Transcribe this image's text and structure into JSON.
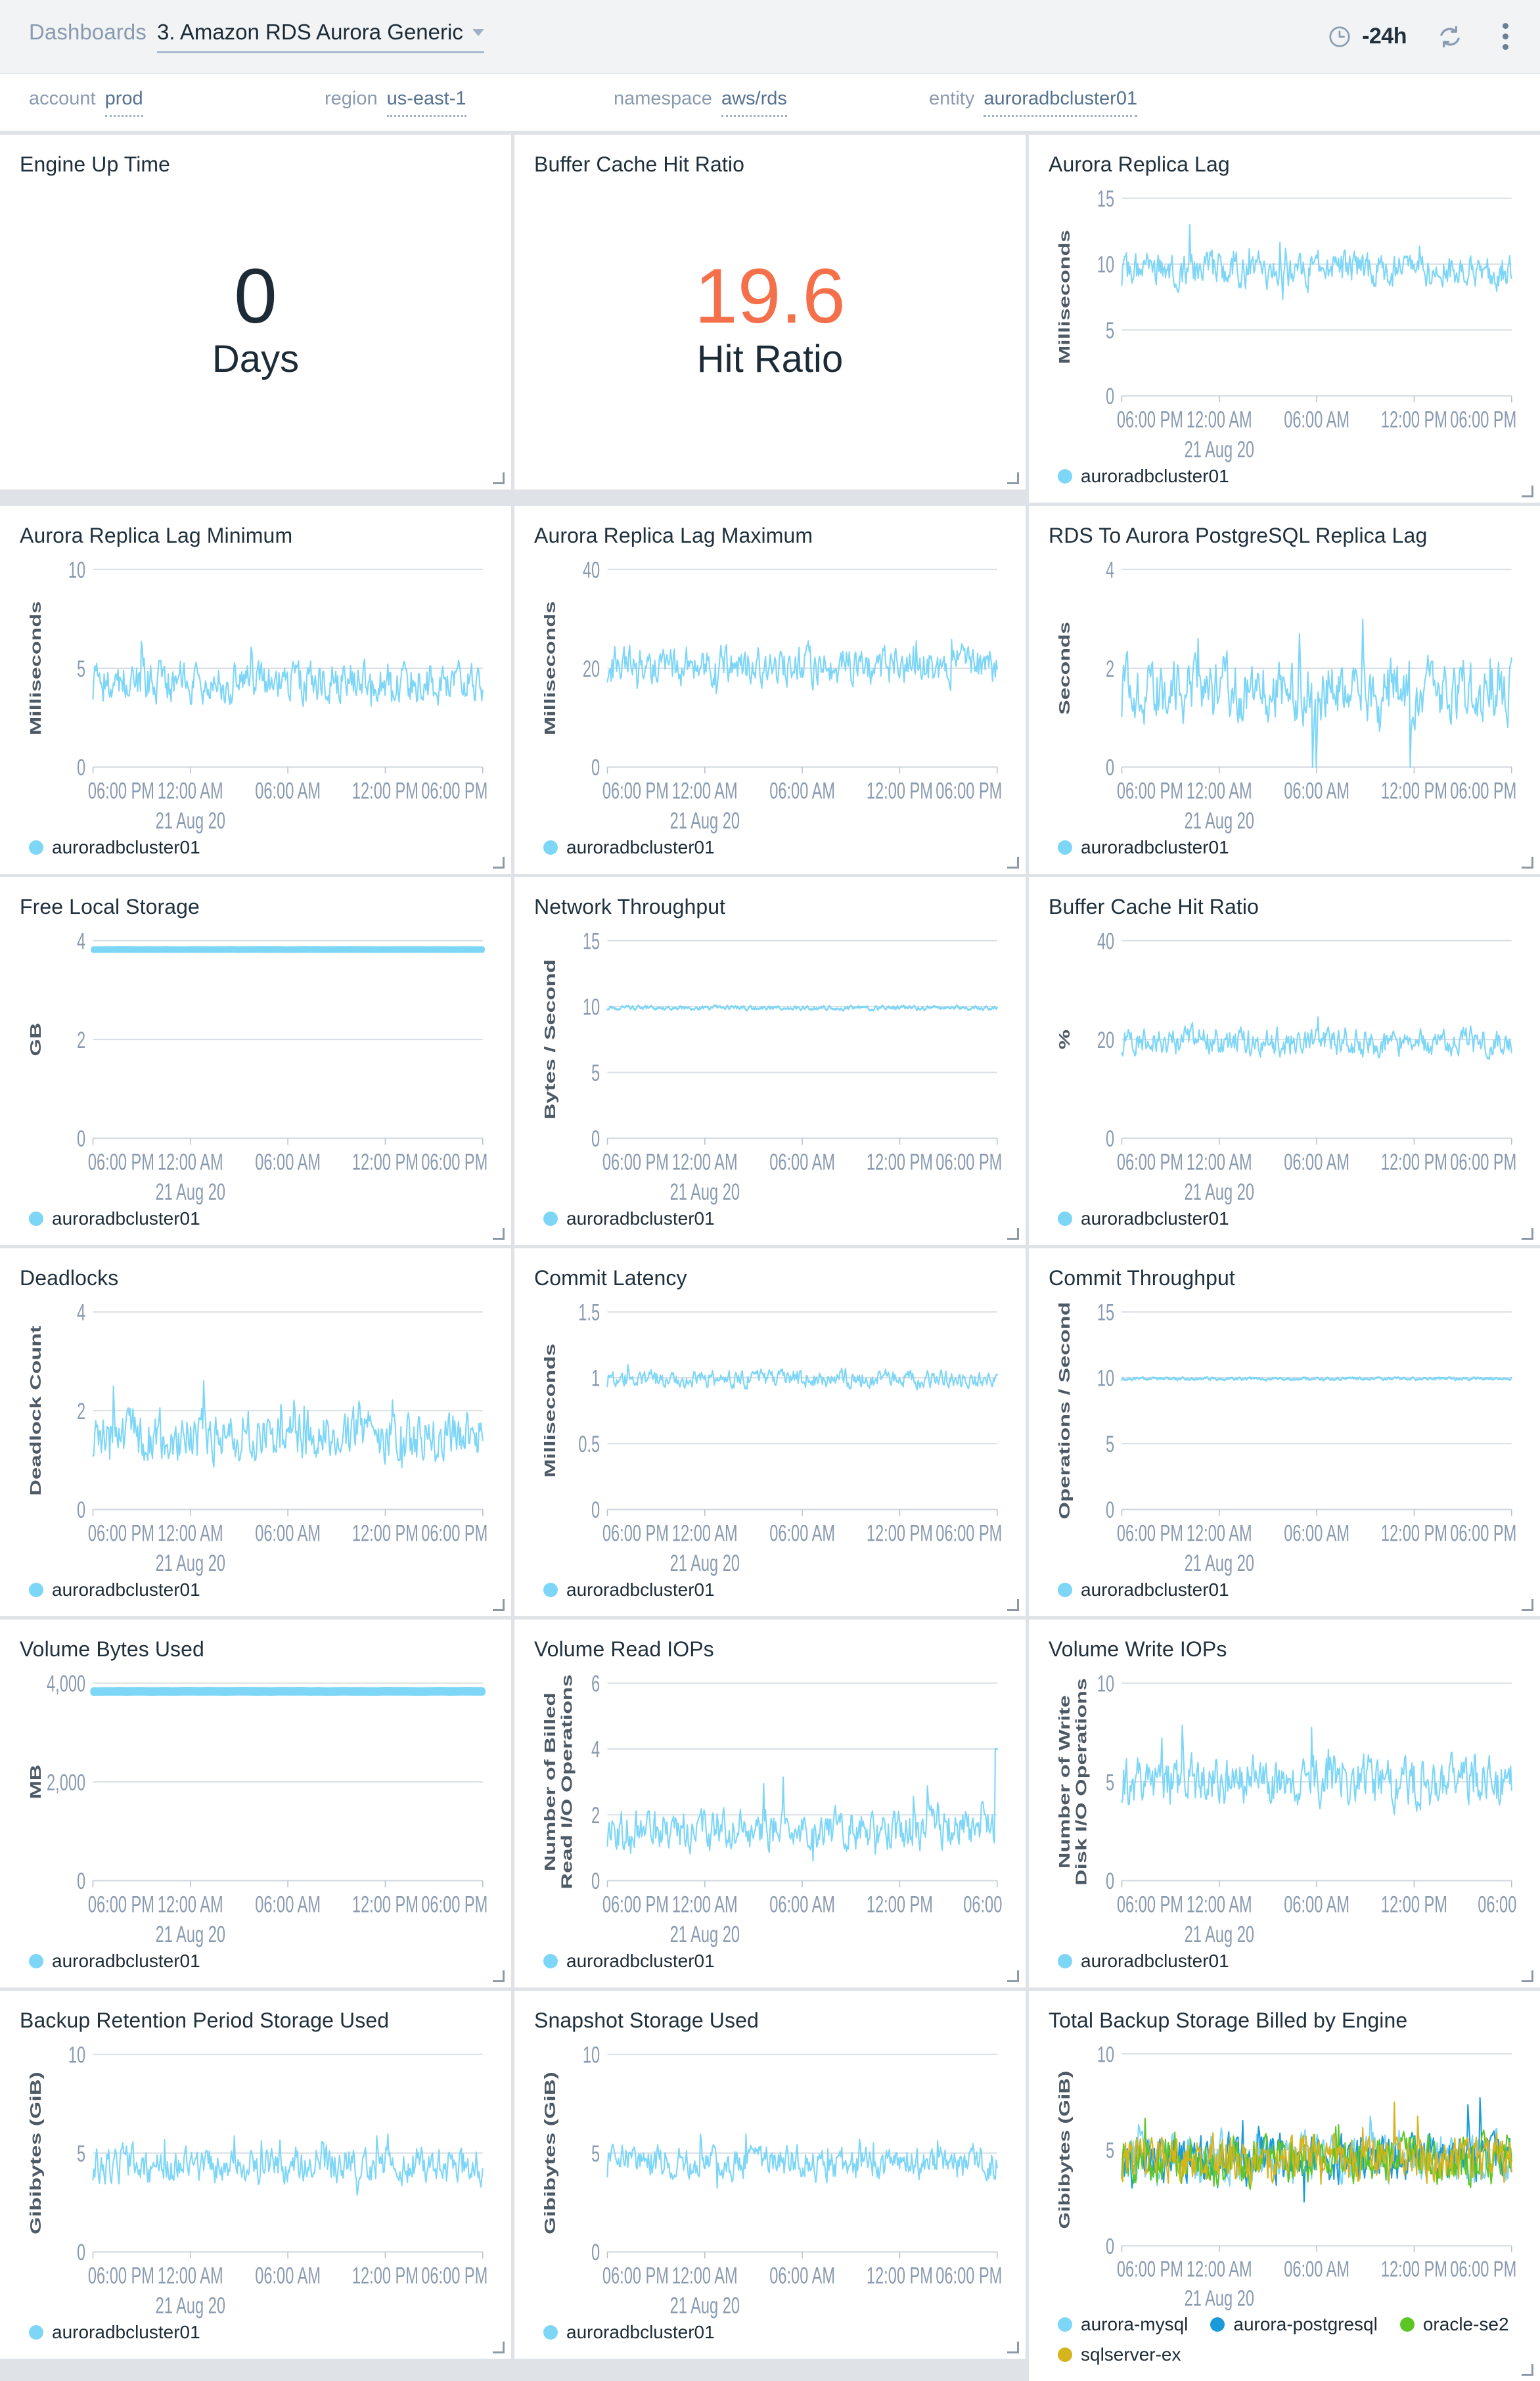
{
  "header": {
    "breadcrumb_root": "Dashboards",
    "title": "3. Amazon RDS Aurora Generic",
    "time_range": "-24h",
    "clock_icon": "clock-icon",
    "refresh_icon": "refresh-icon",
    "more_icon": "kebab-menu-icon"
  },
  "filters": [
    {
      "label": "account",
      "value": "prod"
    },
    {
      "label": "region",
      "value": "us-east-1"
    },
    {
      "label": "namespace",
      "value": "aws/rds"
    },
    {
      "label": "entity",
      "value": "auroradbcluster01"
    }
  ],
  "colors": {
    "series_blue": "#7ed6f7",
    "series_blue_dark": "#1b9bd8",
    "series_green": "#5cc624",
    "series_gold": "#d6b41d",
    "alert_orange": "#f4704a",
    "text_dark": "#1d2b36",
    "axis_text": "#8a9bb0",
    "grid_line": "#d7dde3"
  },
  "billboards": [
    {
      "title": "Engine Up Time",
      "value": "0",
      "caption": "Days",
      "alert": false
    },
    {
      "title": "Buffer Cache Hit Ratio",
      "value": "19.6",
      "caption": "Hit Ratio",
      "alert": true
    }
  ],
  "x_axis": {
    "ticks": [
      "06:00 PM",
      "12:00 AM",
      "06:00 AM",
      "12:00 PM",
      "06:00 PM"
    ],
    "sub_tick_index": 1,
    "sub_tick_label": "21 Aug 20"
  },
  "chart_data": [
    {
      "id": "aurora-replica-lag",
      "type": "line",
      "title": "Aurora Replica Lag",
      "ylabel": "Milliseconds",
      "yticks": [
        0,
        5,
        10,
        15
      ],
      "ylim": [
        0,
        15
      ],
      "xlabel": "",
      "x_ticks": [
        "06:00 PM",
        "12:00 AM",
        "06:00 AM",
        "12:00 PM",
        "06:00 PM"
      ],
      "x_sub_label": "21 Aug 20",
      "legend_position": "bottom",
      "grid": true,
      "series": [
        {
          "name": "auroradbcluster01",
          "color": "#7ed6f7",
          "mean": 9.5,
          "noise": 1.1,
          "spikes": 0.25,
          "seed": 11
        }
      ]
    },
    {
      "id": "aurora-replica-lag-minimum",
      "type": "line",
      "title": "Aurora Replica Lag Minimum",
      "ylabel": "Milliseconds",
      "yticks": [
        0,
        5,
        10
      ],
      "ylim": [
        0,
        10
      ],
      "x_ticks": [
        "06:00 PM",
        "12:00 AM",
        "06:00 AM",
        "12:00 PM",
        "06:00 PM"
      ],
      "x_sub_label": "21 Aug 20",
      "legend_position": "bottom",
      "grid": true,
      "series": [
        {
          "name": "auroradbcluster01",
          "color": "#7ed6f7",
          "mean": 4.3,
          "noise": 0.85,
          "spikes": 0.22,
          "seed": 23
        }
      ]
    },
    {
      "id": "aurora-replica-lag-maximum",
      "type": "line",
      "title": "Aurora Replica Lag Maximum",
      "ylabel": "Milliseconds",
      "yticks": [
        0,
        20,
        40
      ],
      "ylim": [
        0,
        40
      ],
      "x_ticks": [
        "06:00 PM",
        "12:00 AM",
        "06:00 AM",
        "12:00 PM",
        "06:00 PM"
      ],
      "x_sub_label": "21 Aug 20",
      "legend_position": "bottom",
      "grid": true,
      "series": [
        {
          "name": "auroradbcluster01",
          "color": "#7ed6f7",
          "mean": 20.5,
          "noise": 3.2,
          "spikes": 0.2,
          "seed": 37
        }
      ]
    },
    {
      "id": "rds-to-aurora-postgresql-replica-lag",
      "type": "line",
      "title": "RDS To Aurora PostgreSQL Replica Lag",
      "ylabel": "Seconds",
      "yticks": [
        0,
        2,
        4
      ],
      "ylim": [
        0,
        4
      ],
      "x_ticks": [
        "06:00 PM",
        "12:00 AM",
        "06:00 AM",
        "12:00 PM",
        "06:00 PM"
      ],
      "x_sub_label": "21 Aug 20",
      "legend_position": "bottom",
      "grid": true,
      "series": [
        {
          "name": "auroradbcluster01",
          "color": "#7ed6f7",
          "mean": 1.55,
          "noise": 0.52,
          "spikes": 0.5,
          "dropouts": true,
          "seed": 53
        }
      ]
    },
    {
      "id": "free-local-storage",
      "type": "line",
      "title": "Free Local Storage",
      "ylabel": "GB",
      "yticks": [
        0,
        2,
        4
      ],
      "ylim": [
        0,
        4
      ],
      "x_ticks": [
        "06:00 PM",
        "12:00 AM",
        "06:00 AM",
        "12:00 PM",
        "06:00 PM"
      ],
      "x_sub_label": "21 Aug 20",
      "legend_position": "bottom",
      "grid": true,
      "flat": true,
      "series": [
        {
          "name": "auroradbcluster01",
          "color": "#7ed6f7",
          "mean": 3.82,
          "noise": 0.004,
          "seed": 67,
          "width": 7
        }
      ]
    },
    {
      "id": "network-throughput",
      "type": "line",
      "title": "Network Throughput",
      "ylabel": "Bytes / Second",
      "yticks": [
        0,
        5,
        10,
        15
      ],
      "ylim": [
        0,
        15
      ],
      "x_ticks": [
        "06:00 PM",
        "12:00 AM",
        "06:00 AM",
        "12:00 PM",
        "06:00 PM"
      ],
      "x_sub_label": "21 Aug 20",
      "legend_position": "bottom",
      "grid": true,
      "series": [
        {
          "name": "auroradbcluster01",
          "color": "#7ed6f7",
          "mean": 9.9,
          "noise": 0.14,
          "seed": 79
        }
      ]
    },
    {
      "id": "buffer-cache-hit-ratio-chart",
      "type": "line",
      "title": "Buffer Cache Hit Ratio",
      "ylabel": "%",
      "yticks": [
        0,
        20,
        40
      ],
      "ylim": [
        0,
        40
      ],
      "x_ticks": [
        "06:00 PM",
        "12:00 AM",
        "06:00 AM",
        "12:00 PM",
        "06:00 PM"
      ],
      "x_sub_label": "21 Aug 20",
      "legend_position": "bottom",
      "grid": true,
      "series": [
        {
          "name": "auroradbcluster01",
          "color": "#7ed6f7",
          "mean": 19.6,
          "noise": 2.4,
          "spikes": 0.22,
          "seed": 91
        }
      ]
    },
    {
      "id": "deadlocks",
      "type": "line",
      "title": "Deadlocks",
      "ylabel": "Deadlock Count",
      "yticks": [
        0,
        2,
        4
      ],
      "ylim": [
        0,
        4
      ],
      "x_ticks": [
        "06:00 PM",
        "12:00 AM",
        "06:00 AM",
        "12:00 PM",
        "06:00 PM"
      ],
      "x_sub_label": "21 Aug 20",
      "legend_position": "bottom",
      "grid": true,
      "series": [
        {
          "name": "auroradbcluster01",
          "color": "#7ed6f7",
          "mean": 1.5,
          "noise": 0.42,
          "spikes": 0.35,
          "seed": 103
        }
      ]
    },
    {
      "id": "commit-latency",
      "type": "line",
      "title": "Commit Latency",
      "ylabel": "Milliseconds",
      "yticks": [
        0,
        0.5,
        1,
        1.5
      ],
      "ytick_labels": [
        "0",
        "0.5",
        "1",
        "1.5"
      ],
      "ylim": [
        0,
        1.5
      ],
      "x_ticks": [
        "06:00 PM",
        "12:00 AM",
        "06:00 AM",
        "12:00 PM",
        "06:00 PM"
      ],
      "x_sub_label": "21 Aug 20",
      "legend_position": "bottom",
      "grid": true,
      "series": [
        {
          "name": "auroradbcluster01",
          "color": "#7ed6f7",
          "mean": 0.99,
          "noise": 0.055,
          "spikes": 0.2,
          "seed": 113
        }
      ]
    },
    {
      "id": "commit-throughput",
      "type": "line",
      "title": "Commit Throughput",
      "ylabel": "Operations / Second",
      "yticks": [
        0,
        5,
        10,
        15
      ],
      "ylim": [
        0,
        15
      ],
      "x_ticks": [
        "06:00 PM",
        "12:00 AM",
        "06:00 AM",
        "12:00 PM",
        "06:00 PM"
      ],
      "x_sub_label": "21 Aug 20",
      "legend_position": "bottom",
      "grid": true,
      "series": [
        {
          "name": "auroradbcluster01",
          "color": "#7ed6f7",
          "mean": 9.92,
          "noise": 0.1,
          "seed": 127
        }
      ]
    },
    {
      "id": "volume-bytes-used",
      "type": "line",
      "title": "Volume Bytes Used",
      "ylabel": "MB",
      "yticks": [
        0,
        2000,
        4000
      ],
      "ytick_labels": [
        "0",
        "2,000",
        "4,000"
      ],
      "ylim": [
        0,
        4000
      ],
      "x_ticks": [
        "06:00 PM",
        "12:00 AM",
        "06:00 AM",
        "12:00 PM",
        "06:00 PM"
      ],
      "x_sub_label": "21 Aug 20",
      "legend_position": "bottom",
      "grid": true,
      "flat": true,
      "series": [
        {
          "name": "auroradbcluster01",
          "color": "#7ed6f7",
          "mean": 3830,
          "noise": 4,
          "seed": 139,
          "width": 9
        }
      ]
    },
    {
      "id": "volume-read-iops",
      "type": "line",
      "title": "Volume Read IOPs",
      "ylabel": "Number of Billed Read I/O Operations",
      "yticks": [
        0,
        2,
        4,
        6
      ],
      "ylim": [
        0,
        6
      ],
      "x_ticks": [
        "06:00 PM",
        "12:00 AM",
        "06:00 AM",
        "12:00 PM",
        "06:00"
      ],
      "x_sub_label": "21 Aug 20",
      "legend_position": "bottom",
      "grid": true,
      "end_spike": 4,
      "series": [
        {
          "name": "auroradbcluster01",
          "color": "#7ed6f7",
          "mean": 1.55,
          "noise": 0.5,
          "spikes": 0.3,
          "seed": 151
        }
      ]
    },
    {
      "id": "volume-write-iops",
      "type": "line",
      "title": "Volume Write IOPs",
      "ylabel": "Number of Write Disk I/O Operations",
      "yticks": [
        0,
        5,
        10
      ],
      "ylim": [
        0,
        10
      ],
      "x_ticks": [
        "06:00 PM",
        "12:00 AM",
        "06:00 AM",
        "12:00 PM",
        "06:00"
      ],
      "x_sub_label": "21 Aug 20",
      "legend_position": "bottom",
      "grid": true,
      "series": [
        {
          "name": "auroradbcluster01",
          "color": "#7ed6f7",
          "mean": 5.0,
          "noise": 1.05,
          "spikes": 0.25,
          "seed": 163
        }
      ]
    },
    {
      "id": "backup-retention-period-storage-used",
      "type": "line",
      "title": "Backup Retention Period Storage Used",
      "ylabel": "Gibibytes (GiB)",
      "yticks": [
        0,
        5,
        10
      ],
      "ylim": [
        0,
        10
      ],
      "x_ticks": [
        "06:00 PM",
        "12:00 AM",
        "06:00 AM",
        "12:00 PM",
        "06:00 PM"
      ],
      "x_sub_label": "21 Aug 20",
      "legend_position": "bottom",
      "grid": true,
      "series": [
        {
          "name": "auroradbcluster01",
          "color": "#7ed6f7",
          "mean": 4.4,
          "noise": 0.75,
          "spikes": 0.25,
          "seed": 173
        }
      ]
    },
    {
      "id": "snapshot-storage-used",
      "type": "line",
      "title": "Snapshot Storage Used",
      "ylabel": "Gibibytes (GiB)",
      "yticks": [
        0,
        5,
        10
      ],
      "ylim": [
        0,
        10
      ],
      "x_ticks": [
        "06:00 PM",
        "12:00 AM",
        "06:00 AM",
        "12:00 PM",
        "06:00 PM"
      ],
      "x_sub_label": "21 Aug 20",
      "legend_position": "bottom",
      "grid": true,
      "series": [
        {
          "name": "auroradbcluster01",
          "color": "#7ed6f7",
          "mean": 4.5,
          "noise": 0.7,
          "spikes": 0.22,
          "seed": 181
        }
      ]
    },
    {
      "id": "total-backup-storage-billed-by-engine",
      "type": "line",
      "title": "Total Backup Storage Billed by Engine",
      "ylabel": "Gibibytes (GiB)",
      "yticks": [
        0,
        5,
        10
      ],
      "ylim": [
        0,
        10
      ],
      "x_ticks": [
        "06:00 PM",
        "12:00 AM",
        "06:00 AM",
        "12:00 PM",
        "06:00 PM"
      ],
      "x_sub_label": "21 Aug 20",
      "legend_position": "bottom",
      "grid": true,
      "series": [
        {
          "name": "aurora-mysql",
          "color": "#7ed6f7",
          "mean": 4.5,
          "noise": 1.0,
          "spikes": 0.3,
          "seed": 191
        },
        {
          "name": "aurora-postgresql",
          "color": "#1b9bd8",
          "mean": 4.5,
          "noise": 1.0,
          "spikes": 0.3,
          "seed": 197
        },
        {
          "name": "oracle-se2",
          "color": "#5cc624",
          "mean": 4.5,
          "noise": 1.0,
          "spikes": 0.3,
          "seed": 211
        },
        {
          "name": "sqlserver-ex",
          "color": "#d6b41d",
          "mean": 4.5,
          "noise": 1.0,
          "spikes": 0.3,
          "seed": 223
        }
      ]
    }
  ]
}
